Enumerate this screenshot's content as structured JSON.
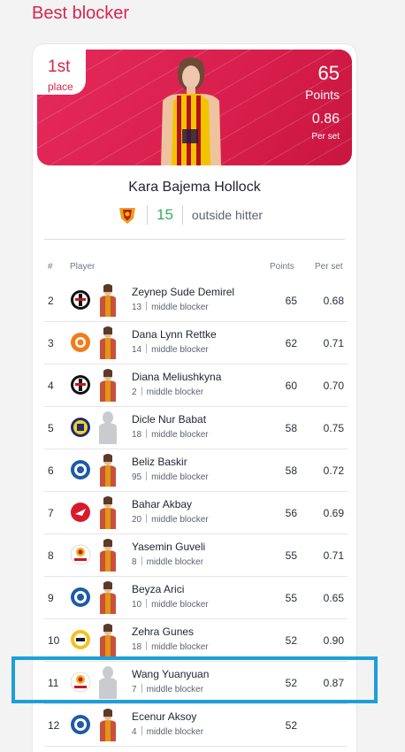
{
  "page_title": "Best blocker",
  "top": {
    "place_number": "1st",
    "place_label": "place",
    "points": "65",
    "points_label": "Points",
    "per_set": "0.86",
    "per_set_label": "Per set",
    "player_name": "Kara Bajema Hollock",
    "jersey_number": "15",
    "position": "outside hitter",
    "team_logo": "galatasaray-logo"
  },
  "table": {
    "headers": {
      "rank": "#",
      "player": "Player",
      "points": "Points",
      "per_set": "Per set"
    },
    "rows": [
      {
        "rank": "2",
        "name": "Zeynep Sude Demirel",
        "number": "13",
        "position": "middle blocker",
        "points": "65",
        "per_set": "0.68",
        "logo": "besiktas-logo",
        "photo": "player-photo"
      },
      {
        "rank": "3",
        "name": "Dana Lynn Rettke",
        "number": "14",
        "position": "middle blocker",
        "points": "62",
        "per_set": "0.71",
        "logo": "eczacibasi-logo",
        "photo": "player-photo"
      },
      {
        "rank": "4",
        "name": "Diana Meliushkyna",
        "number": "2",
        "position": "middle blocker",
        "points": "60",
        "per_set": "0.70",
        "logo": "besiktas-logo",
        "photo": "player-photo"
      },
      {
        "rank": "5",
        "name": "Dicle Nur Babat",
        "number": "18",
        "position": "middle blocker",
        "points": "58",
        "per_set": "0.75",
        "logo": "fenerbahce-logo",
        "photo": "player-silhouette"
      },
      {
        "rank": "6",
        "name": "Beliz Baskir",
        "number": "95",
        "position": "middle blocker",
        "points": "58",
        "per_set": "0.72",
        "logo": "team-logo",
        "photo": "player-photo"
      },
      {
        "rank": "7",
        "name": "Bahar Akbay",
        "number": "20",
        "position": "middle blocker",
        "points": "56",
        "per_set": "0.69",
        "logo": "thy-logo",
        "photo": "player-photo"
      },
      {
        "rank": "8",
        "name": "Yasemin Guveli",
        "number": "8",
        "position": "middle blocker",
        "points": "55",
        "per_set": "0.71",
        "logo": "galatasaray-logo",
        "photo": "player-photo"
      },
      {
        "rank": "9",
        "name": "Beyza Arici",
        "number": "10",
        "position": "middle blocker",
        "points": "55",
        "per_set": "0.65",
        "logo": "team-logo",
        "photo": "player-photo"
      },
      {
        "rank": "10",
        "name": "Zehra Gunes",
        "number": "18",
        "position": "middle blocker",
        "points": "52",
        "per_set": "0.90",
        "logo": "vakifbank-logo",
        "photo": "player-photo"
      },
      {
        "rank": "11",
        "name": "Wang Yuanyuan",
        "number": "7",
        "position": "middle blocker",
        "points": "52",
        "per_set": "0.87",
        "logo": "galatasaray-logo",
        "photo": "player-silhouette"
      },
      {
        "rank": "12",
        "name": "Ecenur Aksoy",
        "number": "4",
        "position": "middle blocker",
        "points": "52",
        "per_set": "",
        "logo": "team-logo",
        "photo": "player-photo"
      }
    ]
  },
  "colors": {
    "accent": "#d7264d",
    "number_green": "#3faa5e",
    "highlight": "#1d9fd9"
  }
}
